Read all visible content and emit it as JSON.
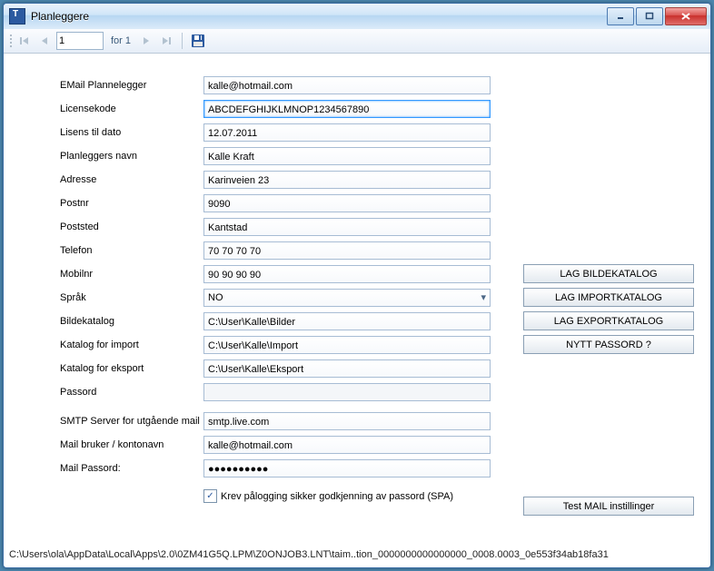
{
  "window": {
    "title": "Planleggere"
  },
  "nav": {
    "page": "1",
    "for_label": "for 1"
  },
  "labels": {
    "email_plannelegger": "EMail Plannelegger",
    "licensekode": "Licensekode",
    "lisens_til_dato": "Lisens til dato",
    "planleggers_navn": "Planleggers navn",
    "adresse": "Adresse",
    "postnr": "Postnr",
    "poststed": "Poststed",
    "telefon": "Telefon",
    "mobilnr": "Mobilnr",
    "sprak": "Språk",
    "bildekatalog": "Bildekatalog",
    "katalog_for_import": "Katalog for import",
    "katalog_for_eksport": "Katalog for eksport",
    "passord": "Passord",
    "smtp_server": "SMTP Server for utgående mail",
    "mail_bruker": "Mail bruker / kontonavn",
    "mail_passord": "Mail Passord:",
    "checkbox": "Krev pålogging sikker godkjenning av passord (SPA)"
  },
  "values": {
    "email_plannelegger": "kalle@hotmail.com",
    "licensekode": "ABCDEFGHIJKLMNOP1234567890",
    "lisens_til_dato": "12.07.2011",
    "planleggers_navn": "Kalle Kraft",
    "adresse": "Karinveien 23",
    "postnr": "9090",
    "poststed": "Kantstad",
    "telefon": "70 70 70 70",
    "mobilnr": "90 90 90 90",
    "sprak": "NO",
    "bildekatalog": "C:\\User\\Kalle\\Bilder",
    "katalog_for_import": "C:\\User\\Kalle\\Import",
    "katalog_for_eksport": "C:\\User\\Kalle\\Eksport",
    "passord": "",
    "smtp_server": "smtp.live.com",
    "mail_bruker": "kalle@hotmail.com",
    "mail_passord": "●●●●●●●●●●"
  },
  "buttons": {
    "lag_bildekatalog": "LAG BILDEKATALOG",
    "lag_importkatalog": "LAG IMPORTKATALOG",
    "lag_exportkatalog": "LAG EXPORTKATALOG",
    "nytt_passord": "NYTT PASSORD ?",
    "test_mail": "Test MAIL instillinger"
  },
  "status": "C:\\Users\\ola\\AppData\\Local\\Apps\\2.0\\0ZM41G5Q.LPM\\Z0ONJOB3.LNT\\taim..tion_0000000000000000_0008.0003_0e553f34ab18fa31"
}
